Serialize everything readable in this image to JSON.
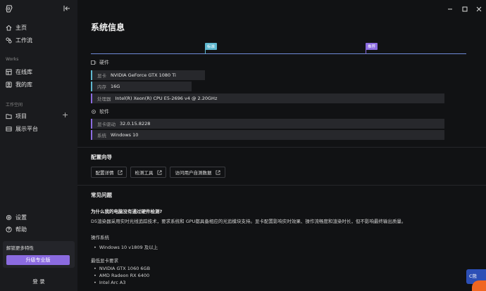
{
  "sidebar": {
    "nav": [
      {
        "label": "主页",
        "icon": "home-icon"
      },
      {
        "label": "工作流",
        "icon": "workflow-icon"
      }
    ],
    "works_label": "Works",
    "works": [
      {
        "label": "在线库",
        "icon": "online-library-icon"
      },
      {
        "label": "我的库",
        "icon": "my-library-icon"
      }
    ],
    "workspace_label": "工作空间",
    "workspace": [
      {
        "label": "项目",
        "icon": "project-icon"
      },
      {
        "label": "展示平台",
        "icon": "showcase-icon"
      }
    ],
    "bottom": [
      {
        "label": "设置",
        "icon": "settings-icon"
      },
      {
        "label": "帮助",
        "icon": "help-icon"
      }
    ],
    "upgrade_title": "解锁更多特性",
    "upgrade_button": "升级专业版",
    "login": "登 录"
  },
  "main": {
    "title": "系统信息",
    "ruler": {
      "tick1": "标准",
      "tick2": "推荐",
      "tick1_color": "#5fb8d0",
      "tick2_color": "#8b6be0"
    },
    "hardware_label": "硬件",
    "hardware": [
      {
        "key": "显卡",
        "value": "NVIDIA GeForce GTX 1080 Ti"
      },
      {
        "key": "内存",
        "value": "16G"
      },
      {
        "key": "处理器",
        "value": "Intel(R) Xeon(R) CPU E5-2696 v4 @ 2.20GHz"
      }
    ],
    "software_label": "软件",
    "software": [
      {
        "key": "显卡驱动",
        "value": "32.0.15.8228"
      },
      {
        "key": "系统",
        "value": "Windows 10"
      }
    ],
    "config_title": "配置向导",
    "config_buttons": [
      "配置详情",
      "检测工具",
      "访问用户自测数据"
    ],
    "faq_title": "常见问题",
    "faq_question": "为什么我的电脑没有通过硬件检测?",
    "faq_answer": "D5渲染器采用实时光线追踪技术，要求系统和 GPU都具备相应的光追模块支持。显卡配置影响实时效果、操作流畅度和渲染时长，但不影响最终输出质量。",
    "os_label": "操作系统",
    "os_items": [
      "Windows 10 v1809 及以上"
    ],
    "gpu_label": "最低显卡要求",
    "gpu_items": [
      "NVIDIA GTX 1060 6GB",
      "AMD Radeon RX 6400",
      "Intel Arc A3"
    ]
  },
  "chat_widget": "C熊"
}
